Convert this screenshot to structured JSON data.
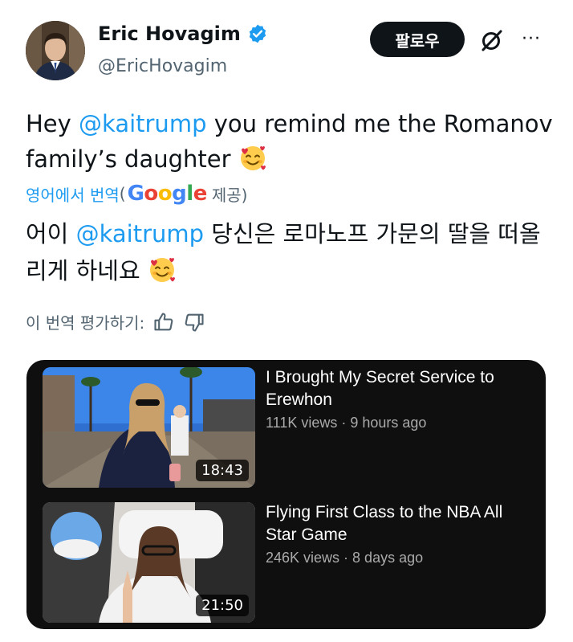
{
  "author": {
    "name": "Eric Hovagim",
    "handle": "@EricHovagim"
  },
  "header": {
    "follow_label": "팔로우",
    "more_label": "···"
  },
  "tweet": {
    "part1": "Hey ",
    "mention": "@kaitrump",
    "part2": " you remind me the Romanov family’s daughter"
  },
  "translation": {
    "link_label": "영어에서 번역",
    "paren_open": "(",
    "google": [
      "G",
      "o",
      "o",
      "g",
      "l",
      "e"
    ],
    "provided": "제공)",
    "part1": "어이 ",
    "mention": "@kaitrump",
    "part2": " 당신은 로마노프 가문의 딸을 떠올리게 하네요"
  },
  "rating": {
    "label": "이 번역 평가하기:"
  },
  "videos": [
    {
      "title": "I Brought My Secret Service to Erewhon",
      "meta": "111K views · 9 hours ago",
      "duration": "18:43"
    },
    {
      "title": "Flying First Class to the NBA All Star Game",
      "meta": "246K views · 8 days ago",
      "duration": "21:50"
    }
  ],
  "colors": {
    "link": "#1d9bf0",
    "text": "#0f1419",
    "muted": "#536471",
    "card_bg": "#0f0f0f"
  }
}
